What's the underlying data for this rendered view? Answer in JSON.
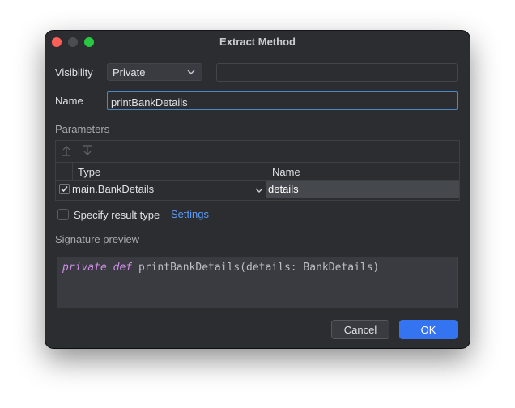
{
  "window": {
    "title": "Extract Method"
  },
  "visibility": {
    "label": "Visibility",
    "selected": "Private"
  },
  "name": {
    "label": "Name",
    "value": "printBankDetails"
  },
  "parameters": {
    "title": "Parameters",
    "columns": [
      "Type",
      "Name"
    ],
    "rows": [
      {
        "checked": true,
        "type": "main.BankDetails",
        "name": "details"
      }
    ]
  },
  "result_type": {
    "label": "Specify result type",
    "link": "Settings",
    "checked": false
  },
  "signature": {
    "title": "Signature preview",
    "keyword1": "private",
    "keyword2": "def",
    "rest": "printBankDetails(details: BankDetails)"
  },
  "buttons": {
    "cancel": "Cancel",
    "ok": "OK"
  },
  "colors": {
    "accent": "#3574f0",
    "focus_border": "#4a88c7",
    "keyword": "#cf8ee6",
    "link": "#5b9bf5"
  }
}
